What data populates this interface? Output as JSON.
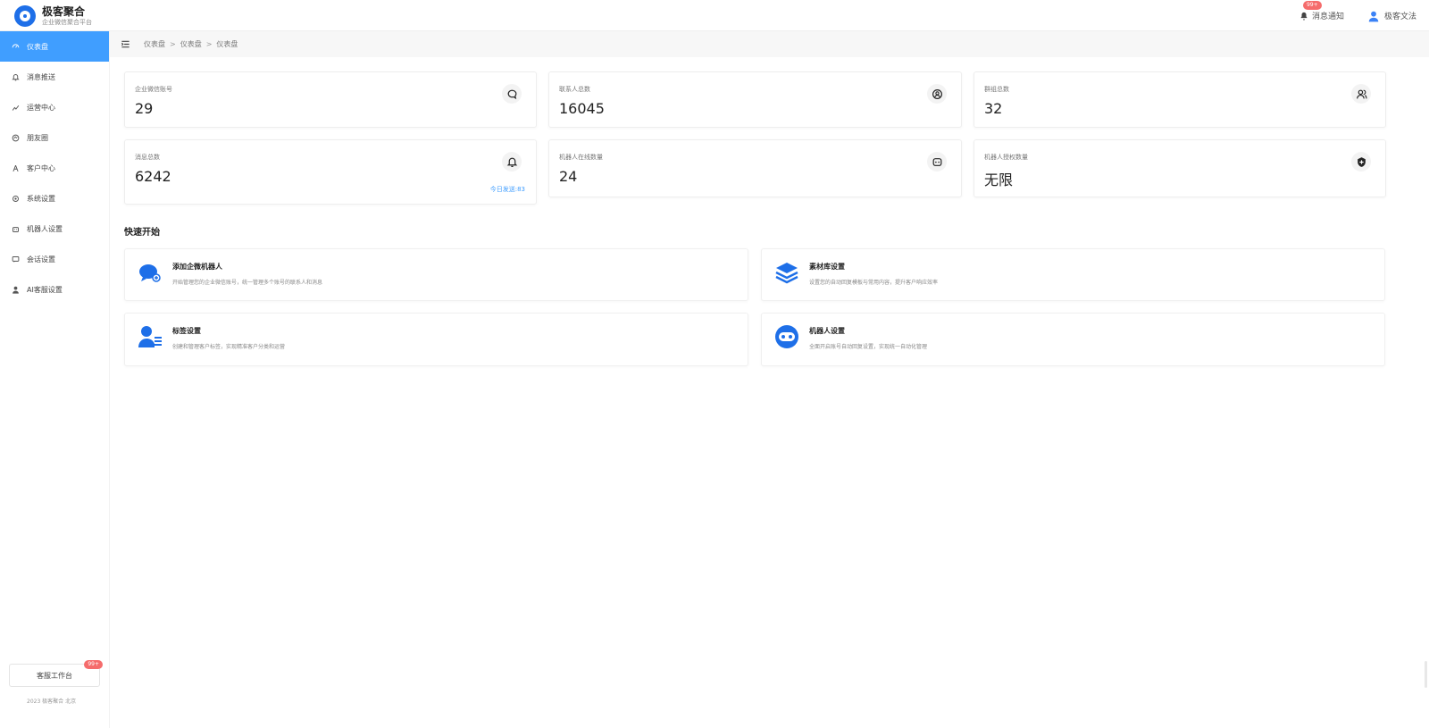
{
  "brand": {
    "name": "极客聚合",
    "subtitle": "企业微信聚合平台"
  },
  "header": {
    "notice_label": "消息通知",
    "notice_badge": "99+",
    "user_label": "极客文法"
  },
  "sidebar": {
    "items": [
      {
        "label": "仪表盘",
        "icon": "dashboard-icon",
        "active": true
      },
      {
        "label": "消息推送",
        "icon": "bell-icon",
        "active": false
      },
      {
        "label": "运营中心",
        "icon": "chart-icon",
        "active": false
      },
      {
        "label": "朋友圈",
        "icon": "moments-icon",
        "active": false
      },
      {
        "label": "客户中心",
        "icon": "customer-icon",
        "active": false
      },
      {
        "label": "系统设置",
        "icon": "gear-icon",
        "active": false
      },
      {
        "label": "机器人设置",
        "icon": "robot-icon",
        "active": false
      },
      {
        "label": "会话设置",
        "icon": "chat-icon",
        "active": false
      },
      {
        "label": "AI客服设置",
        "icon": "person-icon",
        "active": false
      }
    ],
    "workbench_label": "客服工作台",
    "workbench_badge": "99+",
    "copyright": "2023 极客聚合 北京"
  },
  "breadcrumb": [
    "仪表盘",
    "仪表盘",
    "仪表盘"
  ],
  "stats": [
    {
      "label": "企业微信账号",
      "value": "29",
      "icon": "chat-bubble-icon"
    },
    {
      "label": "联系人总数",
      "value": "16045",
      "icon": "contact-icon"
    },
    {
      "label": "群组总数",
      "value": "32",
      "icon": "group-icon"
    },
    {
      "label": "消息总数",
      "value": "6242",
      "icon": "bell-icon",
      "link": "今日发送:83"
    },
    {
      "label": "机器人在线数量",
      "value": "24",
      "icon": "robot-icon"
    },
    {
      "label": "机器人授权数量",
      "value": "无限",
      "icon": "shield-plus-icon"
    }
  ],
  "quick_start": {
    "title": "快速开始",
    "cards": [
      {
        "title": "添加企微机器人",
        "desc": "开始管理您的企业微信账号，统一管理多个账号的联系人和消息",
        "icon": "chat-bubbles-icon"
      },
      {
        "title": "素材库设置",
        "desc": "设置您的自动回复模板与常用内容，提升客户响应效率",
        "icon": "layers-icon"
      },
      {
        "title": "标签设置",
        "desc": "创建和管理客户标签，实现精准客户分类和运营",
        "icon": "user-list-icon"
      },
      {
        "title": "机器人设置",
        "desc": "全面开启账号自动回复设置，实现统一自动化管理",
        "icon": "robot-face-icon"
      }
    ]
  },
  "colors": {
    "accent": "#409eff",
    "brand": "#1e6fe8",
    "badge": "#f56c6c"
  }
}
